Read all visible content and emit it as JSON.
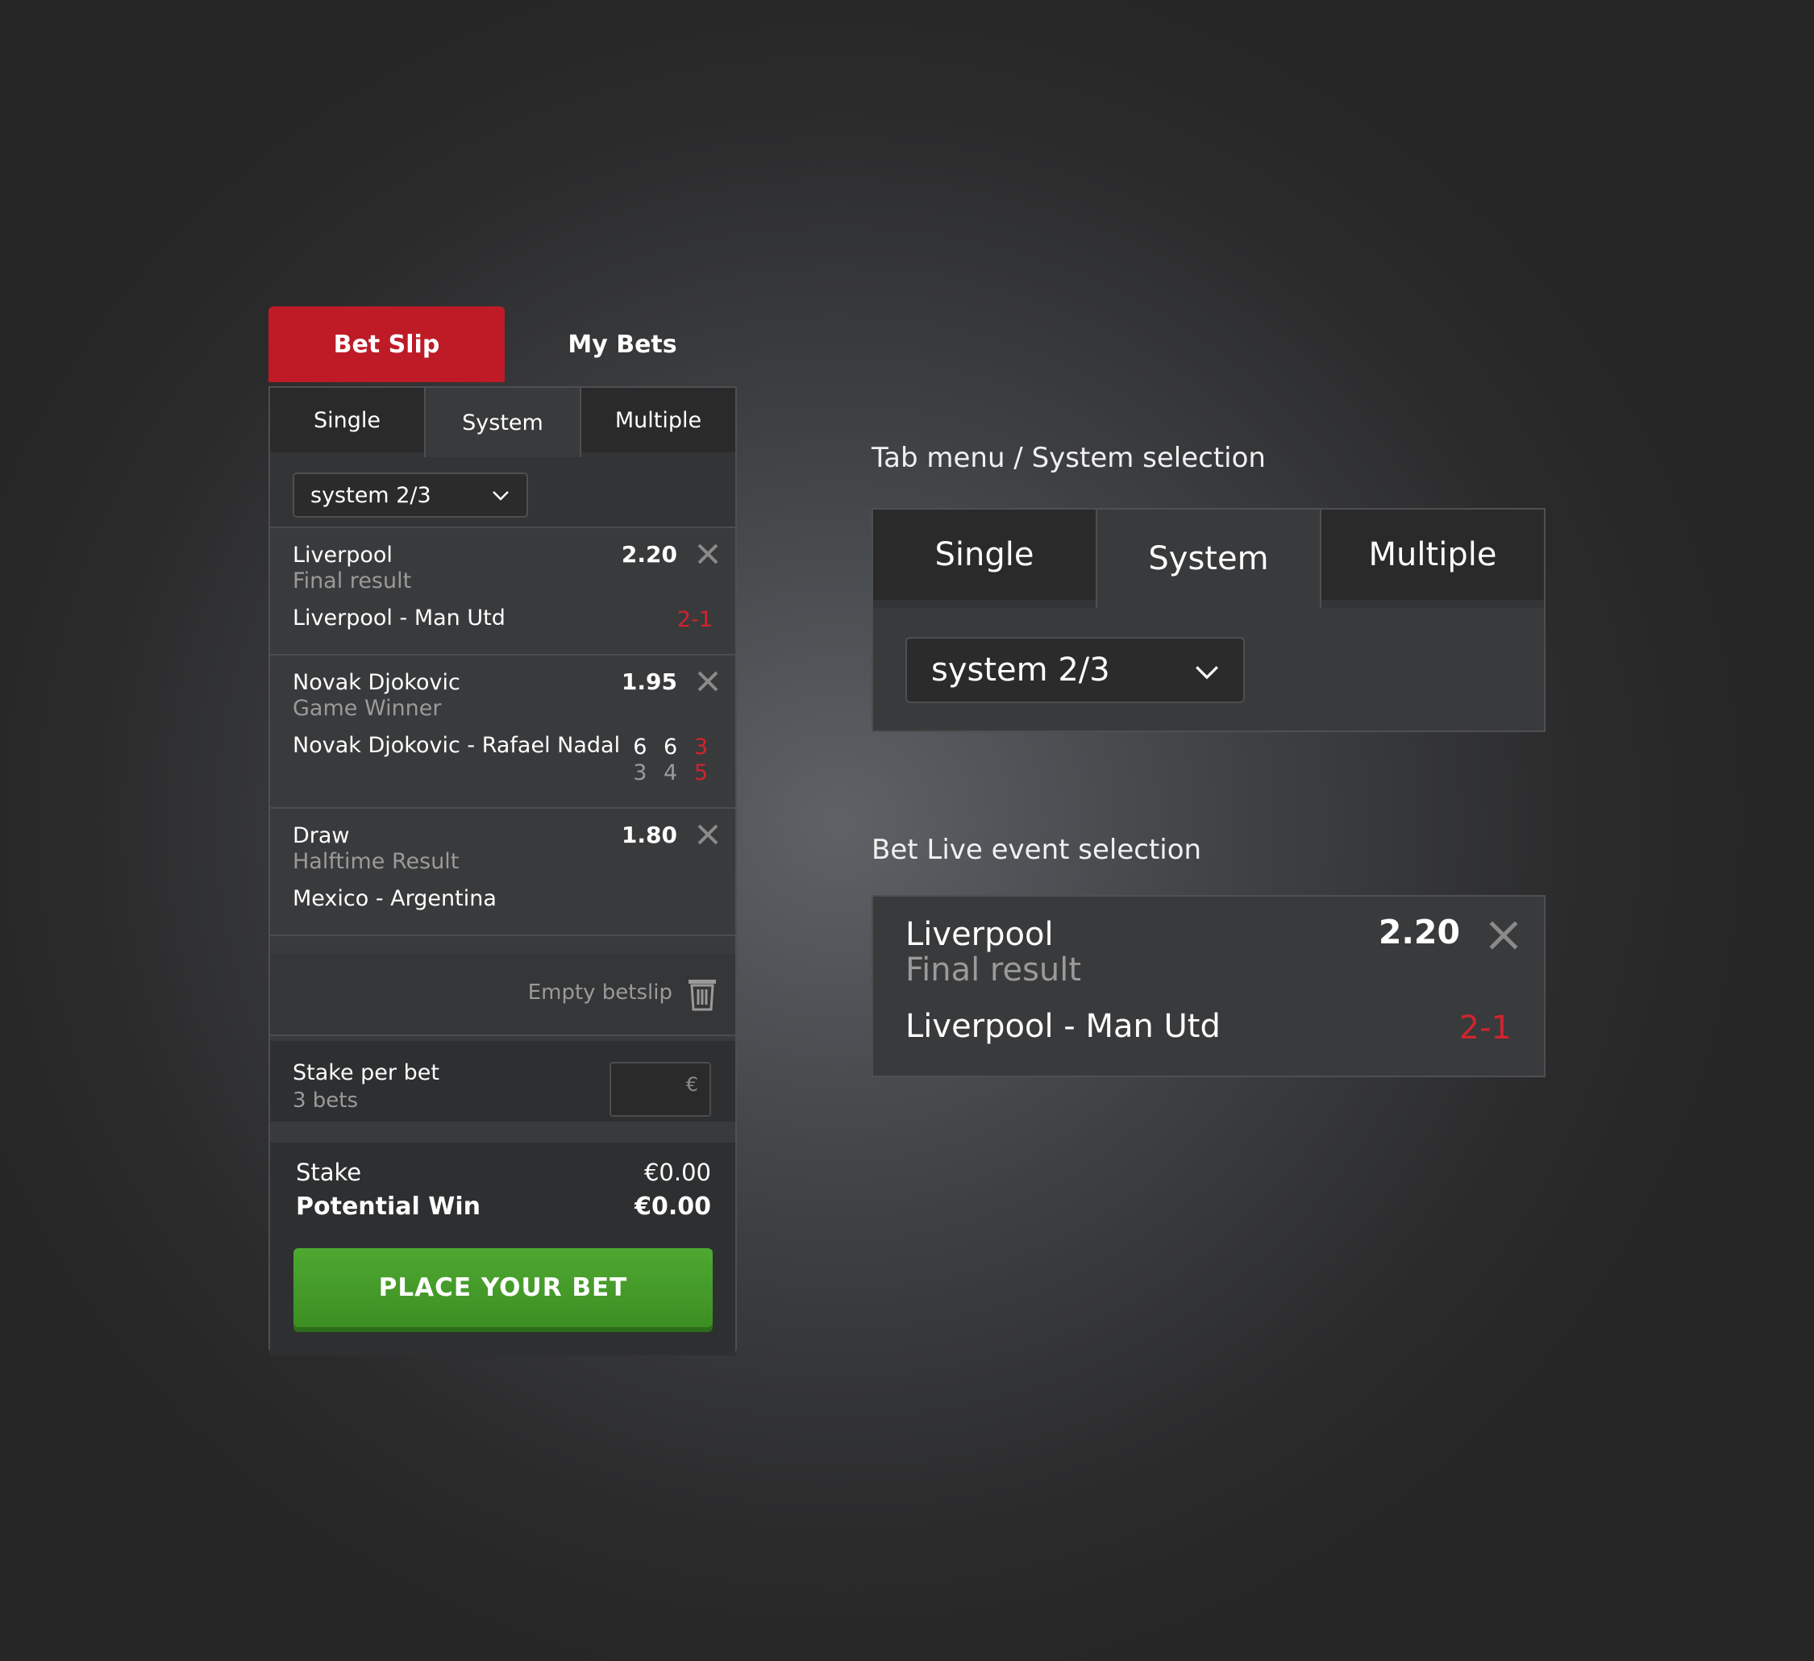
{
  "tabs": {
    "bet_slip": "Bet Slip",
    "my_bets": "My Bets"
  },
  "subtabs": [
    "Single",
    "System",
    "Multiple"
  ],
  "system_select": "system 2/3",
  "bets": [
    {
      "name": "Liverpool",
      "market": "Final result",
      "odds": "2.20",
      "event": "Liverpool - Man Utd",
      "score": "2-1"
    },
    {
      "name": "Novak Djokovic",
      "market": "Game Winner",
      "odds": "1.95",
      "event": "Novak Djokovic - Rafael Nadal",
      "score_top": [
        "6",
        "6",
        "3"
      ],
      "score_bottom": [
        "3",
        "4",
        "5"
      ]
    },
    {
      "name": "Draw",
      "market": "Halftime Result",
      "odds": "1.80",
      "event": "Mexico - Argentina"
    }
  ],
  "empty_betslip": "Empty betslip",
  "stake_per_bet": {
    "label": "Stake per bet",
    "count": "3 bets",
    "currency": "€"
  },
  "summary": {
    "stake_label": "Stake",
    "stake_value": "€0.00",
    "win_label": "Potential Win",
    "win_value": "€0.00"
  },
  "cta": "PLACE YOUR BET",
  "section_titles": {
    "tabs": "Tab menu / System selection",
    "live": "Bet Live event selection"
  },
  "big_tabs": [
    "Single",
    "System",
    "Multiple"
  ],
  "big_select": "system 2/3",
  "big_bet": {
    "name": "Liverpool",
    "market": "Final result",
    "odds": "2.20",
    "event": "Liverpool - Man Utd",
    "score": "2-1"
  },
  "colors": {
    "accent_red": "#be1b27",
    "cta_green": "#46a02c",
    "score_red": "#cf2430"
  }
}
